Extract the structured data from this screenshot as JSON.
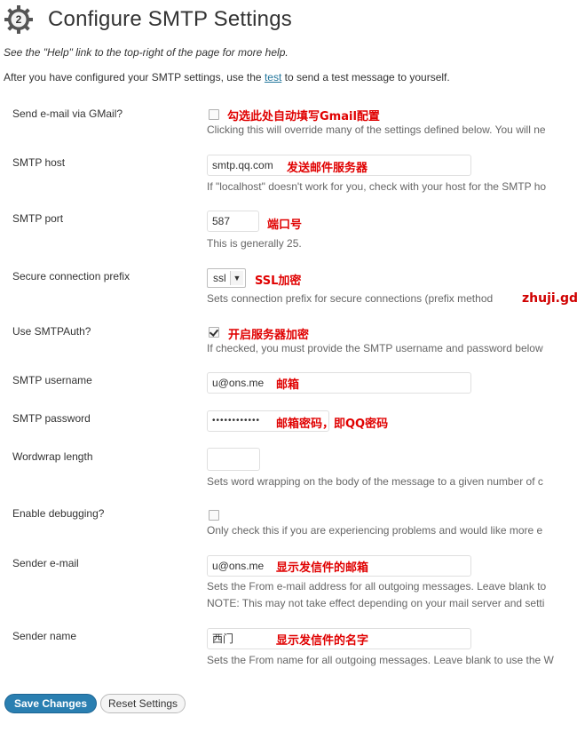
{
  "header": {
    "title": "Configure SMTP Settings",
    "icon": "gear-number-2-icon"
  },
  "help_text": "See the \"Help\" link to the top-right of the page for more help.",
  "intro": {
    "before": "After you have configured your SMTP settings, use the ",
    "link": "test",
    "after": " to send a test message to yourself."
  },
  "rows": {
    "gmail": {
      "label": "Send e-mail via GMail?",
      "checked": false,
      "annotation": "勾选此处自动填写Gmail配置",
      "desc": "Clicking this will override many of the settings defined below. You will ne"
    },
    "host": {
      "label": "SMTP host",
      "value": "smtp.qq.com",
      "annotation": "发送邮件服务器",
      "desc": "If \"localhost\" doesn't work for you, check with your host for the SMTP ho"
    },
    "port": {
      "label": "SMTP port",
      "value": "587",
      "annotation": "端口号",
      "desc": "This is generally 25."
    },
    "secure": {
      "label": "Secure connection prefix",
      "value": "ssl",
      "annotation": "SSL加密",
      "desc": "Sets connection prefix for secure connections (prefix method"
    },
    "auth": {
      "label": "Use SMTPAuth?",
      "checked": true,
      "annotation": "开启服务器加密",
      "desc": "If checked, you must provide the SMTP username and password below"
    },
    "username": {
      "label": "SMTP username",
      "value": "u@ons.me",
      "annotation": "邮箱"
    },
    "password": {
      "label": "SMTP password",
      "value": "••••••••••••",
      "annotation": "邮箱密码，即QQ密码"
    },
    "wordwrap": {
      "label": "Wordwrap length",
      "value": "",
      "desc": "Sets word wrapping on the body of the message to a given number of c"
    },
    "debug": {
      "label": "Enable debugging?",
      "checked": false,
      "desc": "Only check this if you are experiencing problems and would like more e"
    },
    "sender_email": {
      "label": "Sender e-mail",
      "value": "u@ons.me",
      "annotation": "显示发信件的邮箱",
      "desc": "Sets the From e-mail address for all outgoing messages. Leave blank to",
      "note": "NOTE: This may not take effect depending on your mail server and setti"
    },
    "sender_name": {
      "label": "Sender name",
      "value": "西门",
      "annotation": "显示发信件的名字",
      "desc": "Sets the From name for all outgoing messages. Leave blank to use the W"
    }
  },
  "watermark": "zhuji.gd",
  "buttons": {
    "save": "Save Changes",
    "reset": "Reset Settings"
  },
  "colors": {
    "accent": "#2a7fb1",
    "link": "#21759b",
    "annotation": "#e00000"
  }
}
